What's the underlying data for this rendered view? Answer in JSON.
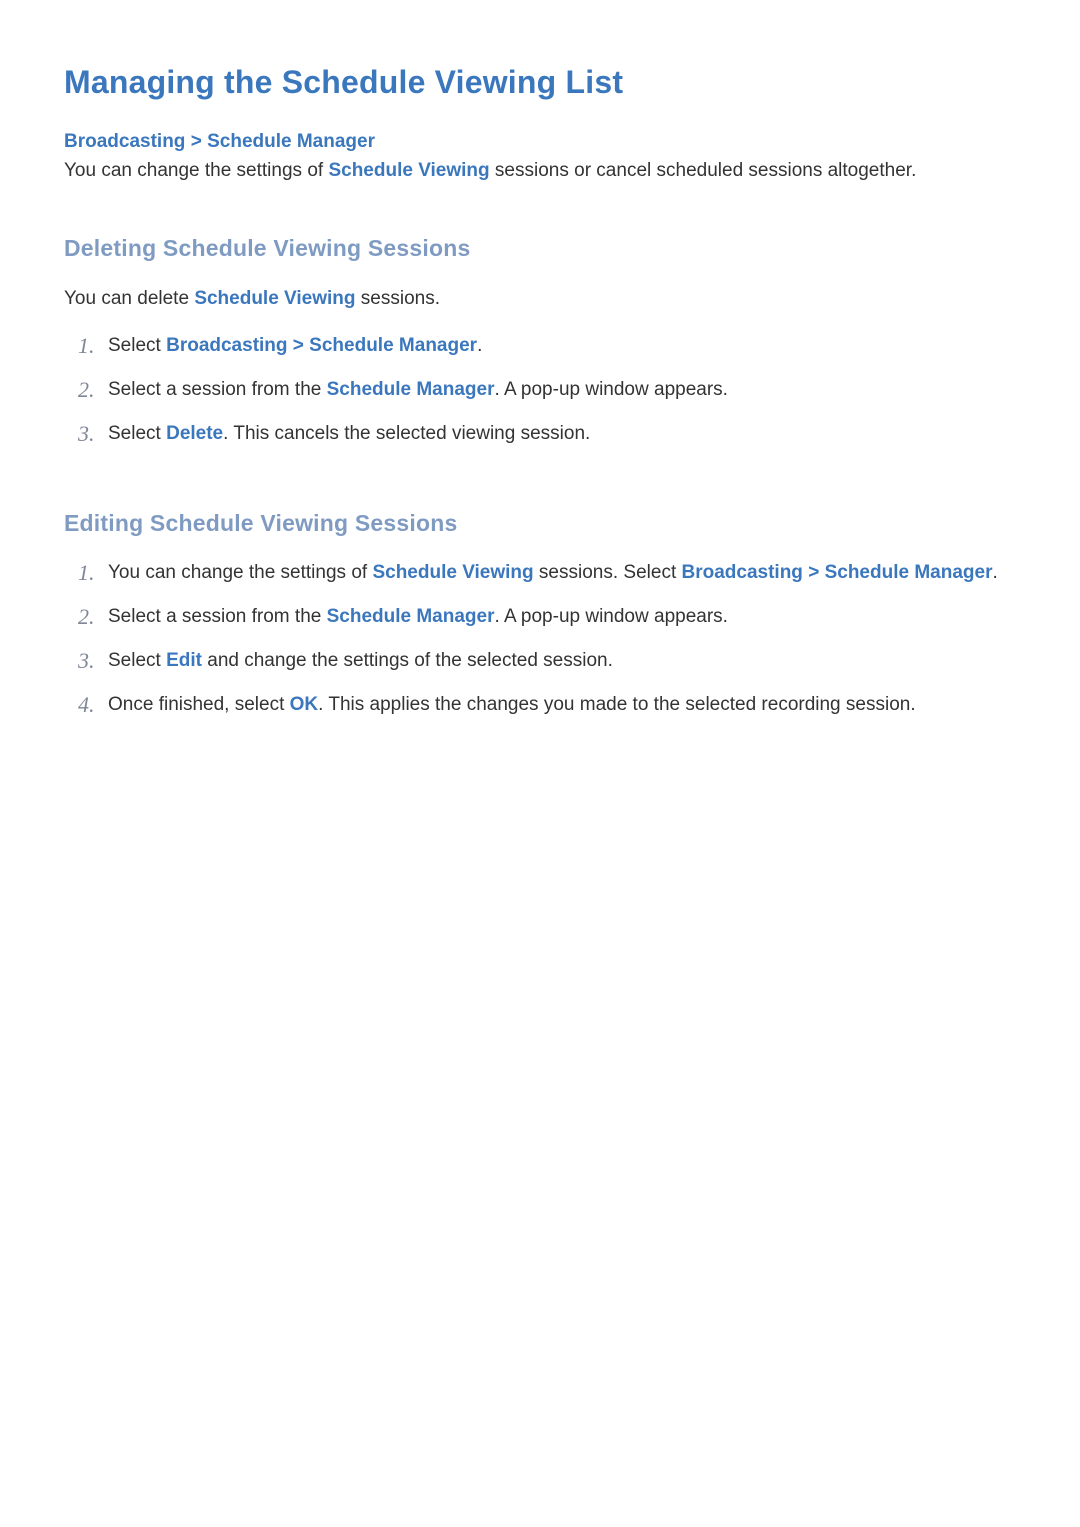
{
  "page": {
    "title": "Managing the Schedule Viewing List"
  },
  "breadcrumb": {
    "item1": "Broadcasting",
    "sep": ">",
    "item2": "Schedule Manager"
  },
  "intro": {
    "pre": "You can change the settings of ",
    "hl": "Schedule Viewing",
    "post": " sessions or cancel scheduled sessions altogether."
  },
  "section1": {
    "title": "Deleting Schedule Viewing Sessions",
    "lead": {
      "pre": "You can delete ",
      "hl": "Schedule Viewing",
      "post": " sessions."
    },
    "steps": {
      "1": {
        "num": "1.",
        "t1": "Select ",
        "hl1": "Broadcasting",
        "sep": " > ",
        "hl2": "Schedule Manager",
        "t2": "."
      },
      "2": {
        "num": "2.",
        "t1": "Select a session from the ",
        "hl1": "Schedule Manager",
        "t2": ". A pop-up window appears."
      },
      "3": {
        "num": "3.",
        "t1": "Select ",
        "hl1": "Delete",
        "t2": ". This cancels the selected viewing session."
      }
    }
  },
  "section2": {
    "title": "Editing Schedule Viewing Sessions",
    "steps": {
      "1": {
        "num": "1.",
        "t1": "You can change the settings of ",
        "hl1": "Schedule Viewing",
        "t2": " sessions. Select ",
        "hl2": "Broadcasting",
        "sep": " > ",
        "hl3": "Schedule Manager",
        "t3": "."
      },
      "2": {
        "num": "2.",
        "t1": "Select a session from the ",
        "hl1": "Schedule Manager",
        "t2": ". A pop-up window appears."
      },
      "3": {
        "num": "3.",
        "t1": "Select ",
        "hl1": "Edit",
        "t2": " and change the settings of the selected session."
      },
      "4": {
        "num": "4.",
        "t1": "Once finished, select ",
        "hl1": "OK",
        "t2": ". This applies the changes you made to the selected recording session."
      }
    }
  }
}
